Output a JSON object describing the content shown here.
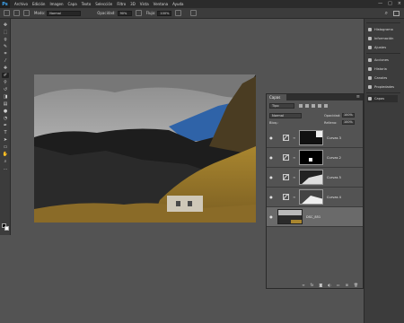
{
  "app": {
    "logo": "Ps"
  },
  "menubar": {
    "items": [
      "Archivo",
      "Edición",
      "Imagen",
      "Capa",
      "Texto",
      "Selección",
      "Filtro",
      "3D",
      "Vista",
      "Ventana",
      "Ayuda"
    ]
  },
  "window_controls": {
    "minimize": "—",
    "restore": "□",
    "close": "×"
  },
  "options": {
    "mode_label": "Modo:",
    "mode_value": "Normal",
    "opacity_label": "Opacidad:",
    "opacity_value": "90%",
    "flow_label": "Flujo:",
    "flow_value": "100%"
  },
  "dock": {
    "items": [
      "Histograma",
      "Información",
      "Ajustes",
      "Acciones",
      "Historia",
      "Canales",
      "Propiedades",
      "Capas"
    ]
  },
  "layers_panel": {
    "tab": "Capas",
    "kind_value": "Tipo",
    "blend_value": "Normal",
    "opacity_label": "Opacidad:",
    "opacity_value": "100%",
    "lock_label": "Bloq.:",
    "fill_label": "Relleno:",
    "fill_value": "100%",
    "layers": [
      {
        "name": "Curvas 3",
        "type": "curves"
      },
      {
        "name": "Curvas 2",
        "type": "curves"
      },
      {
        "name": "Curvas 5",
        "type": "curves"
      },
      {
        "name": "Curvas 4",
        "type": "curves"
      },
      {
        "name": "DSC_851",
        "type": "image"
      }
    ]
  },
  "icons": {
    "eye": "eye-icon",
    "chain": "chain-link-icon",
    "bottom": [
      "link-layers-icon",
      "fx-icon",
      "add-mask-icon",
      "adjustment-layer-icon",
      "group-icon",
      "new-layer-icon",
      "trash-icon"
    ]
  }
}
